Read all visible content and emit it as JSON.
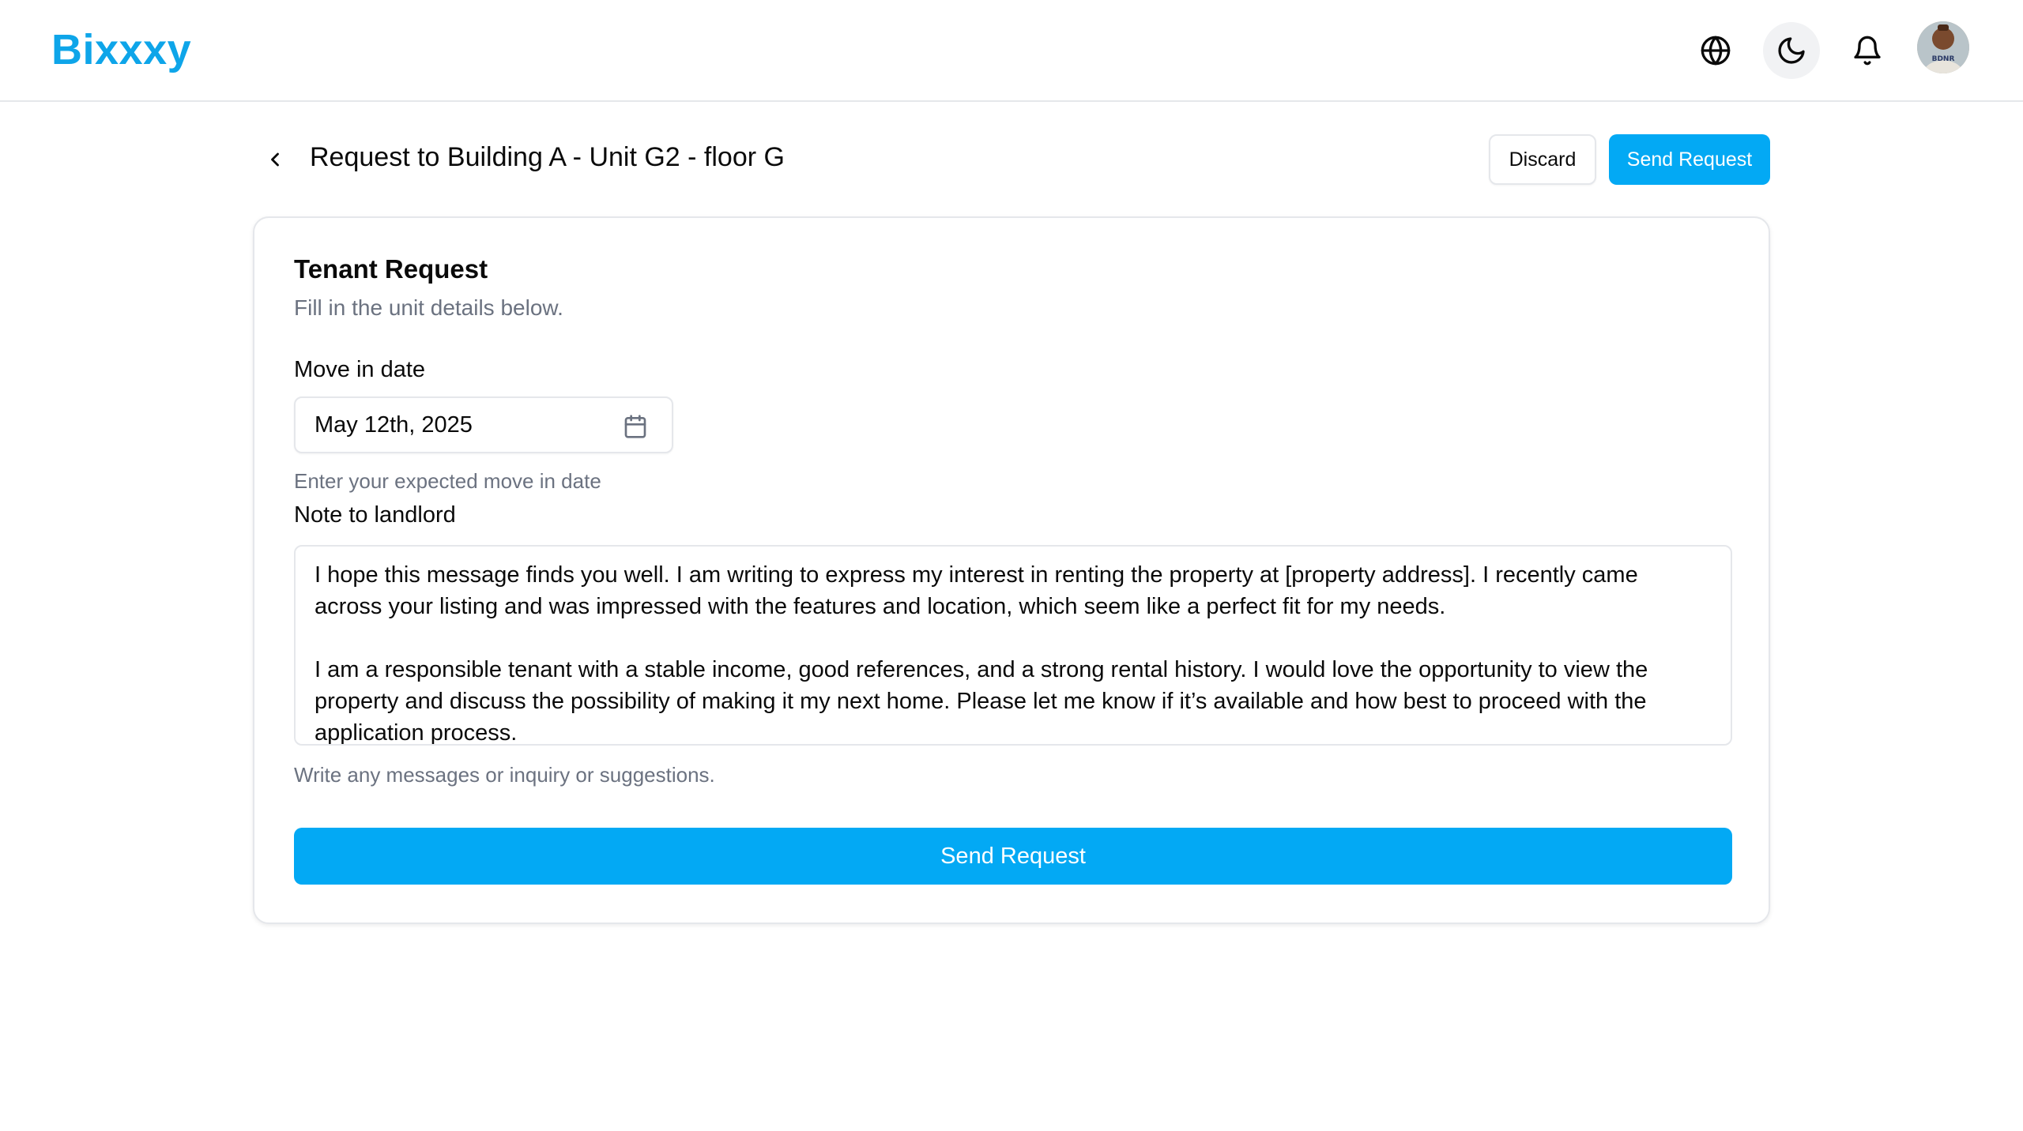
{
  "app": {
    "logo": "Bixxxy",
    "brand_color": "#0ea5e9",
    "accent_color": "#03a9f4"
  },
  "topbar": {
    "icons": [
      "globe-icon",
      "moon-icon",
      "bell-icon"
    ],
    "avatar_alt": "User avatar",
    "avatar_badge_text": "BDNR"
  },
  "header": {
    "back_icon": "chevron-left-icon",
    "title": "Request to Building A - Unit G2 - floor G",
    "discard_label": "Discard",
    "send_label": "Send Request"
  },
  "form": {
    "title": "Tenant Request",
    "subtitle": "Fill in the unit details below.",
    "move_in": {
      "label": "Move in date",
      "value": "May 12th, 2025",
      "icon": "calendar-icon",
      "hint": "Enter your expected move in date"
    },
    "note": {
      "label": "Note to landlord",
      "paragraph_1": "I hope this message finds you well. I am writing to express my interest in renting the property at [property address]. I recently came across your listing and was impressed with the features and location, which seem like a perfect fit for my needs.",
      "paragraph_2": "I am a responsible tenant with a stable income, good references, and a strong rental history. I would love the opportunity to view the property and discuss the possibility of making it my next home. Please let me know if it’s available and how best to proceed with the application process.",
      "hint": "Write any messages or inquiry or suggestions."
    },
    "submit_label": "Send Request"
  }
}
